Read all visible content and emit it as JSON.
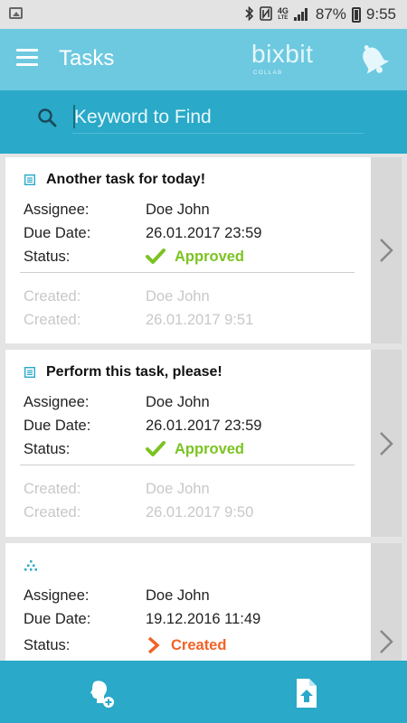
{
  "status_bar": {
    "battery": "87%",
    "time": "9:55",
    "network_top": "4G",
    "network_bottom": "LTE",
    "icons": [
      "image-icon",
      "bluetooth-icon",
      "nfc-icon",
      "signal-icon",
      "battery-icon"
    ]
  },
  "app_bar": {
    "title": "Tasks",
    "brand_name": "bixbit",
    "brand_sub": "COLLAB",
    "menu_icon": "menu-icon",
    "notification_icon": "bell-icon"
  },
  "search": {
    "placeholder": "Keyword to Find",
    "value": ""
  },
  "labels": {
    "assignee": "Assignee:",
    "due_date": "Due Date:",
    "status": "Status:",
    "created": "Created:"
  },
  "tasks": [
    {
      "title": "Another task for today!",
      "type_icon": "task-icon",
      "assignee": "Doe John",
      "due_date": "26.01.2017 23:59",
      "status": "Approved",
      "created_by": "Doe John",
      "created_at": "26.01.2017 9:51"
    },
    {
      "title": "Perform this task, please!",
      "type_icon": "task-icon",
      "assignee": "Doe John",
      "due_date": "26.01.2017 23:59",
      "status": "Approved",
      "created_by": "Doe John",
      "created_at": "26.01.2017 9:50"
    },
    {
      "title": "",
      "type_icon": "hierarchy-icon",
      "assignee": "Doe John",
      "due_date": "19.12.2016 11:49",
      "status": "Created"
    }
  ],
  "colors": {
    "app_bar": "#6cc9e0",
    "search_bar": "#2aa9c8",
    "approved": "#7cc322",
    "created": "#f06326"
  },
  "bottom_nav": {
    "icons": [
      "add-user-icon",
      "upload-file-icon"
    ]
  }
}
